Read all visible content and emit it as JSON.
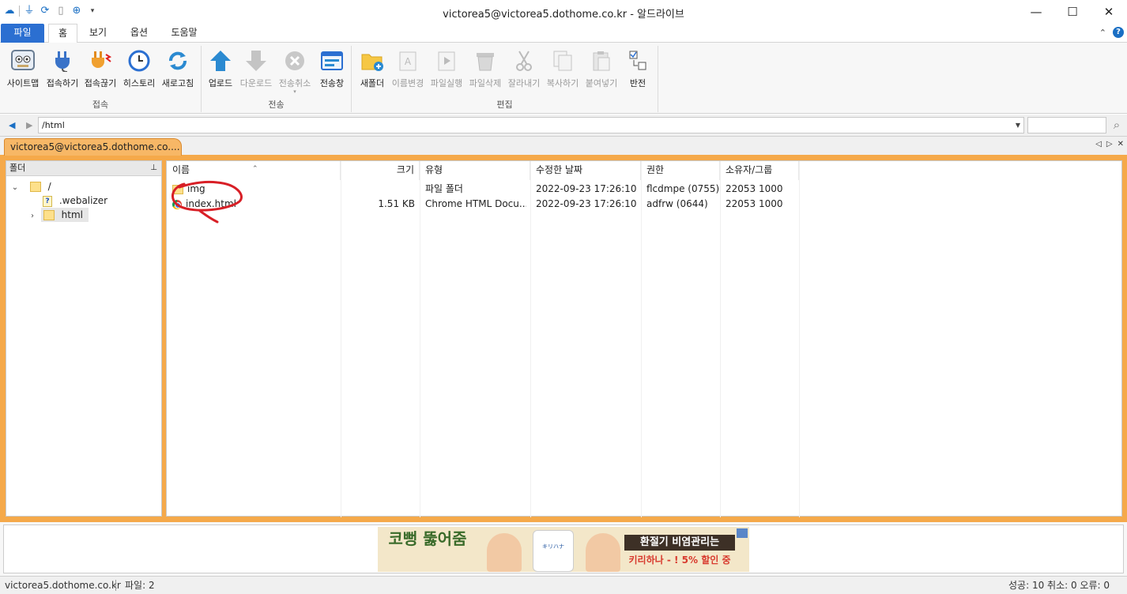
{
  "window": {
    "title": "victorea5@victorea5.dothome.co.kr - 알드라이브",
    "minimize": "—",
    "maximize": "☐",
    "close": "✕"
  },
  "ribbon_tabs": [
    "파일",
    "홈",
    "보기",
    "옵션",
    "도움말"
  ],
  "ribbon": {
    "groups": [
      {
        "label": "접속",
        "buttons": [
          {
            "label": "사이트맵",
            "icon": "sitemap-icon"
          },
          {
            "label": "접속하기",
            "icon": "connect-plug-icon"
          },
          {
            "label": "접속끊기",
            "icon": "disconnect-plug-icon"
          },
          {
            "label": "히스토리",
            "icon": "history-clock-icon"
          },
          {
            "label": "새로고침",
            "icon": "refresh-icon"
          }
        ]
      },
      {
        "label": "전송",
        "buttons": [
          {
            "label": "업로드",
            "icon": "upload-arrow-icon"
          },
          {
            "label": "다운로드",
            "icon": "download-arrow-icon"
          },
          {
            "label": "전송취소",
            "icon": "cancel-transfer-icon"
          },
          {
            "label": "전송창",
            "icon": "transfer-window-icon"
          }
        ]
      },
      {
        "label": "편집",
        "buttons": [
          {
            "label": "새폴더",
            "icon": "new-folder-icon"
          },
          {
            "label": "이름변경",
            "icon": "rename-icon"
          },
          {
            "label": "파일실행",
            "icon": "run-file-icon"
          },
          {
            "label": "파일삭제",
            "icon": "delete-file-icon"
          },
          {
            "label": "잘라내기",
            "icon": "cut-icon"
          },
          {
            "label": "복사하기",
            "icon": "copy-icon"
          },
          {
            "label": "붙여넣기",
            "icon": "paste-icon"
          },
          {
            "label": "반전",
            "icon": "invert-selection-icon"
          }
        ]
      }
    ]
  },
  "address": {
    "path": "/html",
    "search_placeholder": ""
  },
  "session_tab": {
    "label": "victorea5@victorea5.dothome.co...."
  },
  "folder_panel": {
    "header": "폴더",
    "tree": [
      {
        "label": "/",
        "type": "folder",
        "expanded": true
      },
      {
        "label": ".webalizer",
        "type": "file"
      },
      {
        "label": "html",
        "type": "folder",
        "selected": true
      }
    ]
  },
  "file_list": {
    "columns": [
      "이름",
      "크기",
      "유형",
      "수정한 날짜",
      "권한",
      "소유자/그룹"
    ],
    "rows": [
      {
        "name": "img",
        "size": "",
        "type": "파일 폴더",
        "modified": "2022-09-23 17:26:10",
        "perm": "flcdmpe (0755)",
        "owner": "22053 1000",
        "icon": "folder-icon"
      },
      {
        "name": "index.html",
        "size": "1.51 KB",
        "type": "Chrome HTML Docu...",
        "modified": "2022-09-23 17:26:10",
        "perm": "adfrw (0644)",
        "owner": "22053 1000",
        "icon": "chrome-icon"
      }
    ]
  },
  "ad_banner": {
    "left_text": "코뻥 뚫어줌",
    "bottle_text": "キリハナ",
    "headline": "환절기 비염관리는",
    "sub": "키리하나 - ! 5% 할인 중"
  },
  "statusbar": {
    "host": "victorea5.dothome.co.kr",
    "files": "파일: 2",
    "summary": "성공: 10 취소: 0 오류: 0"
  },
  "colors": {
    "accent": "#2b6fd1",
    "tab_orange": "#f7b766",
    "panel_border_orange": "#f5a94a",
    "annotation_red": "#d81f26"
  }
}
